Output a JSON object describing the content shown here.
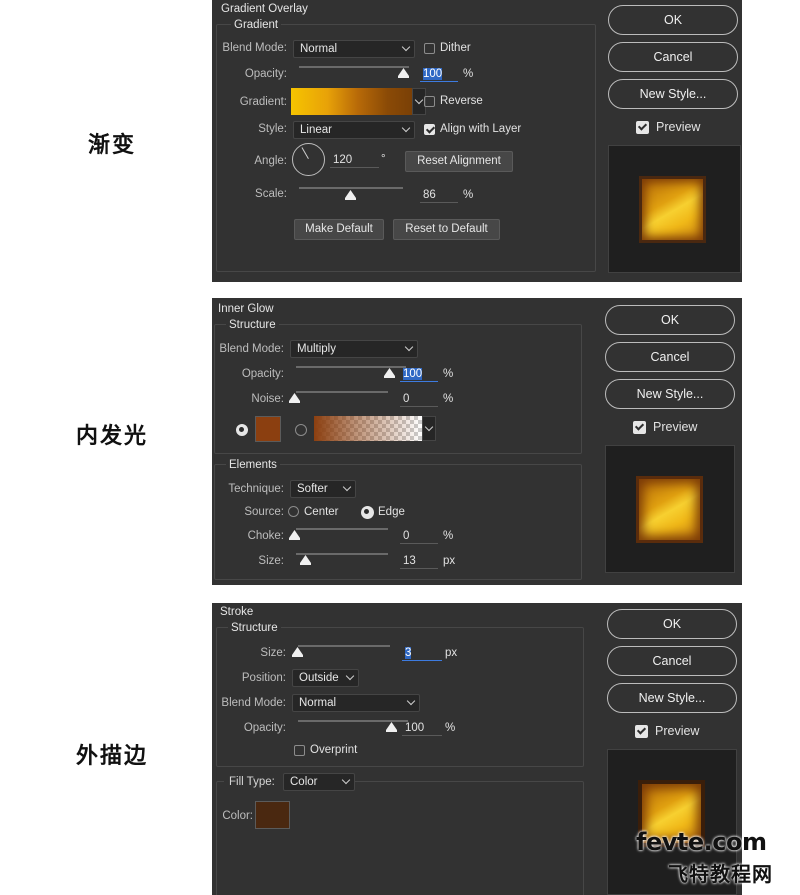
{
  "captions": [
    "渐变",
    "内发光",
    "外描边"
  ],
  "gradient_overlay": {
    "title": "Gradient Overlay",
    "section": "Gradient",
    "blend_mode_label": "Blend Mode:",
    "blend_mode": "Normal",
    "dither_label": "Dither",
    "dither_checked": false,
    "opacity_label": "Opacity:",
    "opacity_value": "100",
    "opacity_fraction": 1.0,
    "opacity_unit": "%",
    "gradient_label": "Gradient:",
    "reverse_label": "Reverse",
    "reverse_checked": false,
    "style_label": "Style:",
    "style_value": "Linear",
    "align_label": "Align with Layer",
    "align_checked": true,
    "angle_label": "Angle:",
    "angle_value": "120",
    "angle_unit": "°",
    "reset_alignment_label": "Reset Alignment",
    "scale_label": "Scale:",
    "scale_value": "86",
    "scale_unit": "%",
    "make_default_label": "Make Default",
    "reset_default_label": "Reset to Default"
  },
  "inner_glow": {
    "title": "Inner Glow",
    "section": "Structure",
    "blend_mode_label": "Blend Mode:",
    "blend_mode": "Multiply",
    "opacity_label": "Opacity:",
    "opacity_value": "100",
    "opacity_unit": "%",
    "noise_label": "Noise:",
    "noise_value": "0",
    "noise_unit": "%",
    "glow_color": "#8b3f10",
    "elements_section": "Elements",
    "technique_label": "Technique:",
    "technique_value": "Softer",
    "source_label": "Source:",
    "source_center": "Center",
    "source_edge": "Edge",
    "choke_label": "Choke:",
    "choke_value": "0",
    "choke_unit": "%",
    "size_label": "Size:",
    "size_value": "13",
    "size_unit": "px"
  },
  "stroke": {
    "title": "Stroke",
    "section": "Structure",
    "size_label": "Size:",
    "size_value": "3",
    "size_unit": "px",
    "position_label": "Position:",
    "position_value": "Outside",
    "blend_mode_label": "Blend Mode:",
    "blend_mode": "Normal",
    "opacity_label": "Opacity:",
    "opacity_value": "100",
    "opacity_unit": "%",
    "overprint_label": "Overprint",
    "overprint_checked": false,
    "fill_type_label": "Fill Type:",
    "fill_type_value": "Color",
    "color_label": "Color:",
    "stroke_color": "#4a2810"
  },
  "side_buttons": {
    "ok": "OK",
    "cancel": "Cancel",
    "new_style": "New Style...",
    "preview": "Preview",
    "preview_checked": true
  },
  "watermark": {
    "line1": "fevte.com",
    "line2": "飞特教程网"
  },
  "colors": {
    "panel_bg": "#323232",
    "gold_light": "#f3c020",
    "gold_dark": "#8a4a08",
    "accent_blue": "#2f68c4"
  }
}
